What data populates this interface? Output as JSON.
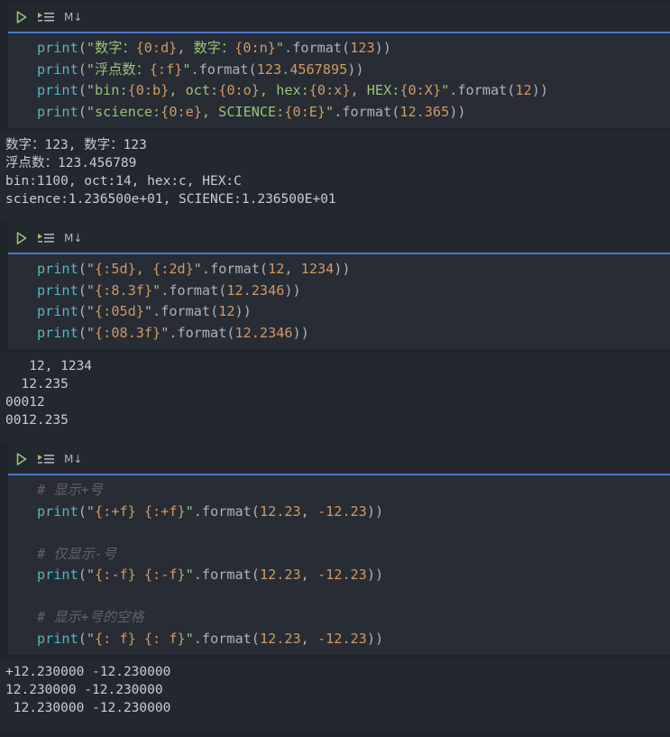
{
  "cells": [
    {
      "toolbar": {
        "markdown_label": "M↓"
      },
      "code": [
        [
          [
            "kw",
            "print"
          ],
          [
            "pl",
            "("
          ],
          [
            "st",
            "\"数字："
          ],
          [
            "fm",
            "{0:d}"
          ],
          [
            "st",
            ", 数字："
          ],
          [
            "fm",
            "{0:n}"
          ],
          [
            "st",
            "\""
          ],
          [
            "pl",
            ".format("
          ],
          [
            "nu",
            "123"
          ],
          [
            "pl",
            "))"
          ]
        ],
        [
          [
            "kw",
            "print"
          ],
          [
            "pl",
            "("
          ],
          [
            "st",
            "\"浮点数："
          ],
          [
            "fm",
            "{:f}"
          ],
          [
            "st",
            "\""
          ],
          [
            "pl",
            ".format("
          ],
          [
            "nu",
            "123.4567895"
          ],
          [
            "pl",
            "))"
          ]
        ],
        [
          [
            "kw",
            "print"
          ],
          [
            "pl",
            "("
          ],
          [
            "st",
            "\"bin:"
          ],
          [
            "fm",
            "{0:b}"
          ],
          [
            "st",
            ", oct:"
          ],
          [
            "fm",
            "{0:o}"
          ],
          [
            "st",
            ", hex:"
          ],
          [
            "fm",
            "{0:x}"
          ],
          [
            "st",
            ", HEX:"
          ],
          [
            "fm",
            "{0:X}"
          ],
          [
            "st",
            "\""
          ],
          [
            "pl",
            ".format("
          ],
          [
            "nu",
            "12"
          ],
          [
            "pl",
            "))"
          ]
        ],
        [
          [
            "kw",
            "print"
          ],
          [
            "pl",
            "("
          ],
          [
            "st",
            "\"science:"
          ],
          [
            "fm",
            "{0:e}"
          ],
          [
            "st",
            ", SCIENCE:"
          ],
          [
            "fm",
            "{0:E}"
          ],
          [
            "st",
            "\""
          ],
          [
            "pl",
            ".format("
          ],
          [
            "nu",
            "12.365"
          ],
          [
            "pl",
            "))"
          ]
        ]
      ],
      "output": [
        "数字：123, 数字：123",
        "浮点数：123.456789",
        "bin:1100, oct:14, hex:c, HEX:C",
        "science:1.236500e+01, SCIENCE:1.236500E+01"
      ]
    },
    {
      "toolbar": {
        "markdown_label": "M↓"
      },
      "code": [
        [
          [
            "kw",
            "print"
          ],
          [
            "pl",
            "("
          ],
          [
            "st",
            "\""
          ],
          [
            "fm",
            "{:5d}"
          ],
          [
            "st",
            ", "
          ],
          [
            "fm",
            "{:2d}"
          ],
          [
            "st",
            "\""
          ],
          [
            "pl",
            ".format("
          ],
          [
            "nu",
            "12"
          ],
          [
            "pl",
            ", "
          ],
          [
            "nu",
            "1234"
          ],
          [
            "pl",
            "))"
          ]
        ],
        [
          [
            "kw",
            "print"
          ],
          [
            "pl",
            "("
          ],
          [
            "st",
            "\""
          ],
          [
            "fm",
            "{:8.3f}"
          ],
          [
            "st",
            "\""
          ],
          [
            "pl",
            ".format("
          ],
          [
            "nu",
            "12.2346"
          ],
          [
            "pl",
            "))"
          ]
        ],
        [
          [
            "kw",
            "print"
          ],
          [
            "pl",
            "("
          ],
          [
            "st",
            "\""
          ],
          [
            "fm",
            "{:05d}"
          ],
          [
            "st",
            "\""
          ],
          [
            "pl",
            ".format("
          ],
          [
            "nu",
            "12"
          ],
          [
            "pl",
            "))"
          ]
        ],
        [
          [
            "kw",
            "print"
          ],
          [
            "pl",
            "("
          ],
          [
            "st",
            "\""
          ],
          [
            "fm",
            "{:08.3f}"
          ],
          [
            "st",
            "\""
          ],
          [
            "pl",
            ".format("
          ],
          [
            "nu",
            "12.2346"
          ],
          [
            "pl",
            "))"
          ]
        ]
      ],
      "output": [
        "   12, 1234",
        "  12.235",
        "00012",
        "0012.235"
      ]
    },
    {
      "toolbar": {
        "markdown_label": "M↓"
      },
      "code": [
        [
          [
            "cm",
            "# 显示+号"
          ]
        ],
        [
          [
            "kw",
            "print"
          ],
          [
            "pl",
            "("
          ],
          [
            "st",
            "\""
          ],
          [
            "fm",
            "{:+f}"
          ],
          [
            "st",
            " "
          ],
          [
            "fm",
            "{:+f}"
          ],
          [
            "st",
            "\""
          ],
          [
            "pl",
            ".format("
          ],
          [
            "nu",
            "12.23"
          ],
          [
            "pl",
            ", "
          ],
          [
            "nu",
            "-12.23"
          ],
          [
            "pl",
            "))"
          ]
        ],
        [],
        [
          [
            "cm",
            "# 仅显示-号"
          ]
        ],
        [
          [
            "kw",
            "print"
          ],
          [
            "pl",
            "("
          ],
          [
            "st",
            "\""
          ],
          [
            "fm",
            "{:-f}"
          ],
          [
            "st",
            " "
          ],
          [
            "fm",
            "{:-f}"
          ],
          [
            "st",
            "\""
          ],
          [
            "pl",
            ".format("
          ],
          [
            "nu",
            "12.23"
          ],
          [
            "pl",
            ", "
          ],
          [
            "nu",
            "-12.23"
          ],
          [
            "pl",
            "))"
          ]
        ],
        [],
        [
          [
            "cm",
            "# 显示+号的空格"
          ]
        ],
        [
          [
            "kw",
            "print"
          ],
          [
            "pl",
            "("
          ],
          [
            "st",
            "\""
          ],
          [
            "fm",
            "{: f}"
          ],
          [
            "st",
            " "
          ],
          [
            "fm",
            "{: f}"
          ],
          [
            "st",
            "\""
          ],
          [
            "pl",
            ".format("
          ],
          [
            "nu",
            "12.23"
          ],
          [
            "pl",
            ", "
          ],
          [
            "nu",
            "-12.23"
          ],
          [
            "pl",
            "))"
          ]
        ]
      ],
      "output": [
        "+12.230000 -12.230000",
        "12.230000 -12.230000",
        " 12.230000 -12.230000"
      ]
    }
  ],
  "icons": {
    "run": "run-cell-icon",
    "run_below": "execute-below-icon"
  },
  "colors": {
    "accent": "#4d78cc",
    "run_icon": "#98c379",
    "keyword": "#56b6c2",
    "string": "#98c379",
    "format_spec": "#d19a66",
    "number": "#d19a66",
    "comment": "#5c6370"
  }
}
